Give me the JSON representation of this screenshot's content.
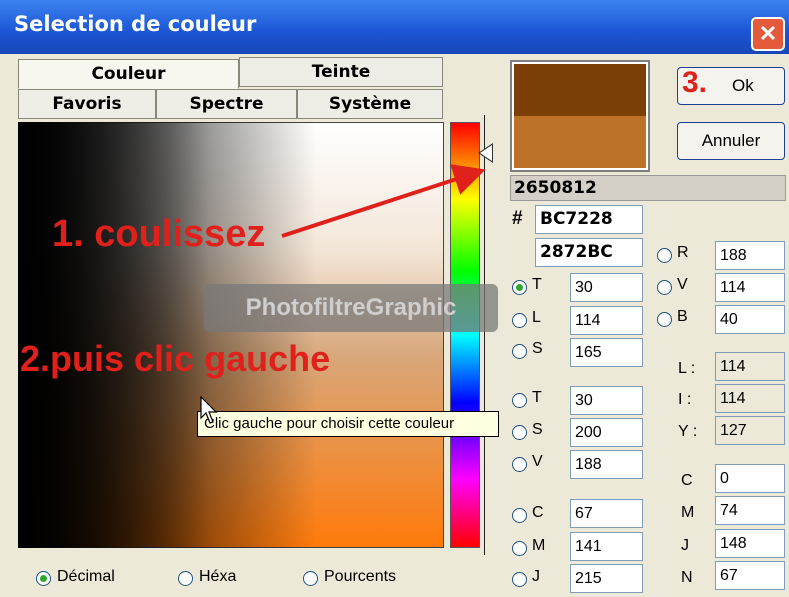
{
  "window": {
    "title": "Selection de couleur",
    "close_glyph": "✕"
  },
  "tabs": {
    "row1": [
      "Couleur",
      "Teinte"
    ],
    "row2": [
      "Favoris",
      "Spectre",
      "Système"
    ]
  },
  "swatch": {
    "new_color": "#7c3f08",
    "old_color": "#bc7228"
  },
  "buttons": {
    "ok": "Ok",
    "cancel": "Annuler"
  },
  "color_value": "2650812",
  "hex": {
    "symbol": "#",
    "value": "BC7228",
    "reverse": "2872BC"
  },
  "rgb": [
    {
      "label": "R",
      "value": "188"
    },
    {
      "label": "V",
      "value": "114"
    },
    {
      "label": "B",
      "value": "40"
    }
  ],
  "tls": [
    {
      "label": "T",
      "value": "30",
      "selected": true
    },
    {
      "label": "L",
      "value": "114",
      "selected": false
    },
    {
      "label": "S",
      "value": "165",
      "selected": false
    }
  ],
  "liy": [
    {
      "label": "L :",
      "value": "114"
    },
    {
      "label": "I :",
      "value": "114"
    },
    {
      "label": "Y :",
      "value": "127"
    }
  ],
  "tsv": [
    {
      "label": "T",
      "value": "30"
    },
    {
      "label": "S",
      "value": "200"
    },
    {
      "label": "V",
      "value": "188"
    }
  ],
  "cmj": [
    {
      "label": "C",
      "value": "67"
    },
    {
      "label": "M",
      "value": "141"
    },
    {
      "label": "J",
      "value": "215"
    }
  ],
  "cmjn": [
    {
      "label": "C",
      "value": "0"
    },
    {
      "label": "M",
      "value": "74"
    },
    {
      "label": "J",
      "value": "148"
    },
    {
      "label": "N",
      "value": "67"
    }
  ],
  "format": {
    "options": [
      "Décimal",
      "Héxa",
      "Pourcents"
    ],
    "selected": "Décimal"
  },
  "annotations": {
    "step1": "1. coulissez",
    "step2": "2.puis clic gauche",
    "step3": "3."
  },
  "watermark": "PhotofiltreGraphic",
  "tooltip": "Clic gauche pour choisir cette couleur"
}
